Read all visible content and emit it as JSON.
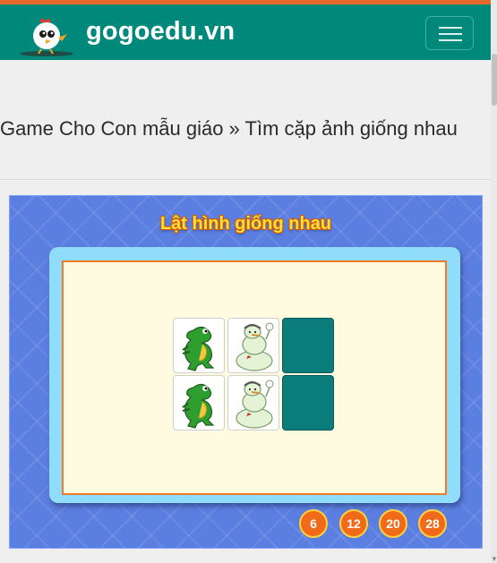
{
  "site": {
    "brand": "gogoedu.vn"
  },
  "breadcrumb": {
    "text": "Game Cho Con mẫu giáo » Tìm cặp ảnh giống nhau"
  },
  "game": {
    "title": "Lật hình giống nhau",
    "cards": [
      {
        "state": "face",
        "icon": "dinosaur-icon"
      },
      {
        "state": "face",
        "icon": "snowman-icon"
      },
      {
        "state": "back",
        "icon": "card-back"
      },
      {
        "state": "face",
        "icon": "dinosaur-icon"
      },
      {
        "state": "face",
        "icon": "snowman-icon"
      },
      {
        "state": "back",
        "icon": "card-back"
      }
    ],
    "levels": [
      "6",
      "12",
      "20",
      "28"
    ]
  },
  "colors": {
    "navbar": "#00897b",
    "accent": "#e56a2c",
    "game_bg": "#5b7fe0",
    "card_back": "#0a7c7c",
    "level_button": "#f06a1a"
  }
}
